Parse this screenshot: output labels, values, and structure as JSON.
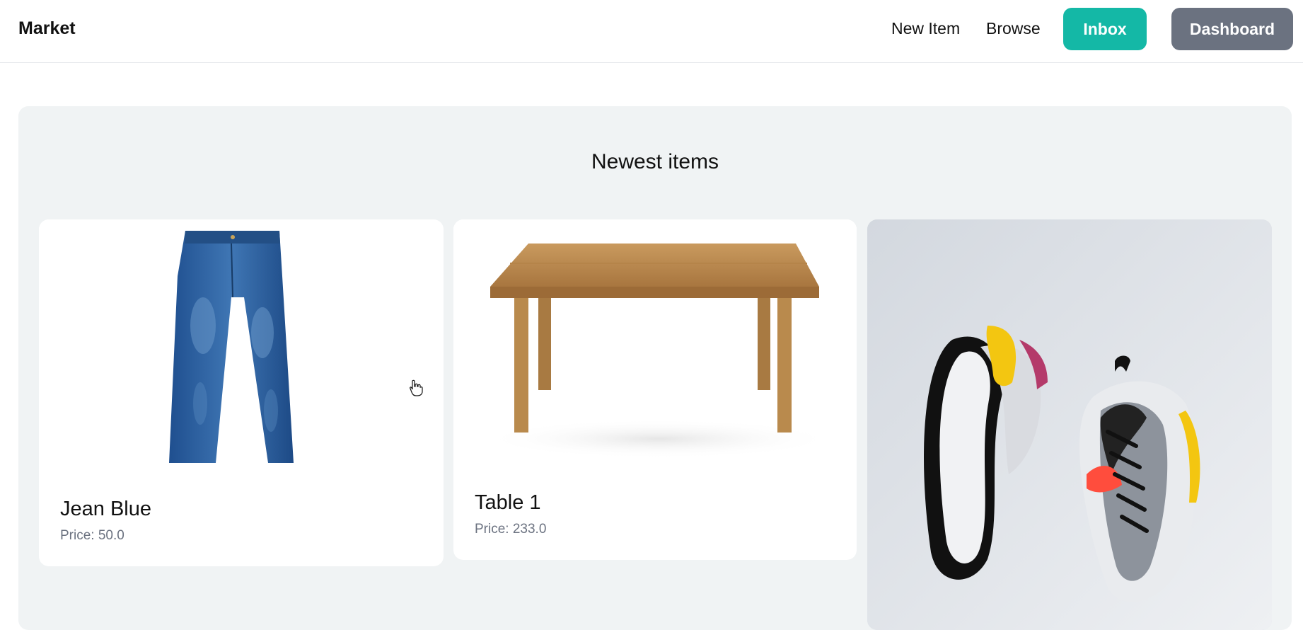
{
  "nav": {
    "brand": "Market",
    "links": {
      "new_item": "New Item",
      "browse": "Browse"
    },
    "buttons": {
      "inbox": "Inbox",
      "dashboard": "Dashboard"
    },
    "colors": {
      "inbox": "#14b8a6",
      "dashboard": "#6b7280"
    }
  },
  "section": {
    "title": "Newest items",
    "items": [
      {
        "name": "Jean Blue",
        "price": "Price: 50.0",
        "image_icon": "jeans-icon"
      },
      {
        "name": "Table 1",
        "price": "Price: 233.0",
        "image_icon": "table-icon"
      },
      {
        "name": "",
        "price": "",
        "image_icon": "sneakers-icon"
      }
    ]
  }
}
